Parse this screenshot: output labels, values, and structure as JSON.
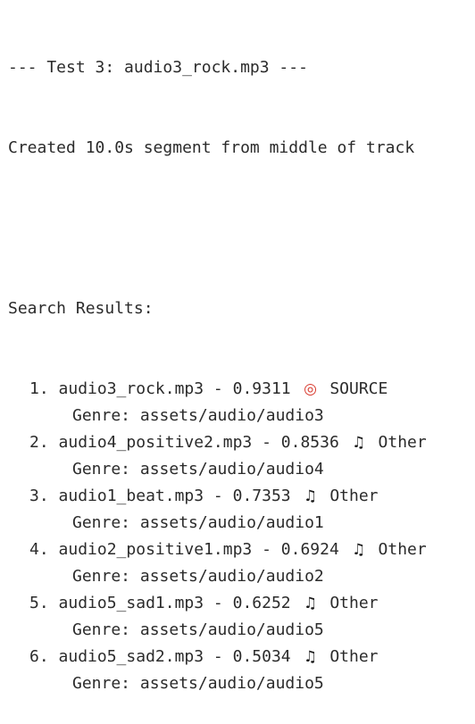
{
  "header": {
    "test_line": "--- Test 3: audio3_rock.mp3 ---",
    "created_line": "Created 10.0s segment from middle of track"
  },
  "results": {
    "heading": "Search Results:",
    "items": [
      {
        "rank": "1.",
        "file": "audio3_rock.mp3",
        "score": "0.9311",
        "icon": "target-icon",
        "tag": "SOURCE",
        "genre": "Genre: assets/audio/audio3"
      },
      {
        "rank": "2.",
        "file": "audio4_positive2.mp3",
        "score": "0.8536",
        "icon": "music-note-icon",
        "tag": "Other",
        "genre": "Genre: assets/audio/audio4"
      },
      {
        "rank": "3.",
        "file": "audio1_beat.mp3",
        "score": "0.7353",
        "icon": "music-note-icon",
        "tag": "Other",
        "genre": "Genre: assets/audio/audio1"
      },
      {
        "rank": "4.",
        "file": "audio2_positive1.mp3",
        "score": "0.6924",
        "icon": "music-note-icon",
        "tag": "Other",
        "genre": "Genre: assets/audio/audio2"
      },
      {
        "rank": "5.",
        "file": "audio5_sad1.mp3",
        "score": "0.6252",
        "icon": "music-note-icon",
        "tag": "Other",
        "genre": "Genre: assets/audio/audio5"
      },
      {
        "rank": "6.",
        "file": "audio5_sad2.mp3",
        "score": "0.5034",
        "icon": "music-note-icon",
        "tag": "Other",
        "genre": "Genre: assets/audio/audio5"
      }
    ]
  },
  "separator": " - ",
  "colors": {
    "background": "#ffffff",
    "text": "#2b2b2b",
    "target_icon": "#d83a2e"
  }
}
